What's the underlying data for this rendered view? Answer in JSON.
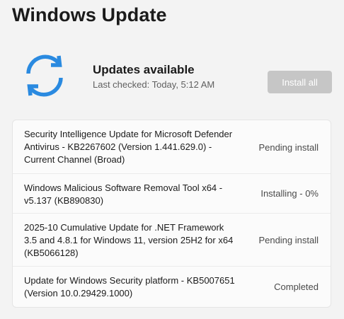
{
  "page": {
    "title": "Windows Update"
  },
  "status": {
    "title": "Updates available",
    "last_checked": "Last checked: Today, 5:12 AM",
    "icon": "sync-icon",
    "install_all_label": "Install all"
  },
  "colors": {
    "accent": "#0f6cbd",
    "button_disabled_bg": "#c6c6c6",
    "background": "#f3f3f3",
    "card": "#fbfbfb"
  },
  "updates": [
    {
      "name": "Security Intelligence Update for Microsoft Defender Antivirus - KB2267602 (Version 1.441.629.0) - Current Channel (Broad)",
      "status": "Pending install"
    },
    {
      "name": "Windows Malicious Software Removal Tool x64 - v5.137 (KB890830)",
      "status": "Installing - 0%"
    },
    {
      "name": "2025-10 Cumulative Update for .NET Framework 3.5 and 4.8.1 for Windows 11, version 25H2 for x64 (KB5066128)",
      "status": "Pending install"
    },
    {
      "name": "Update for Windows Security platform - KB5007651 (Version 10.0.29429.1000)",
      "status": "Completed"
    }
  ]
}
